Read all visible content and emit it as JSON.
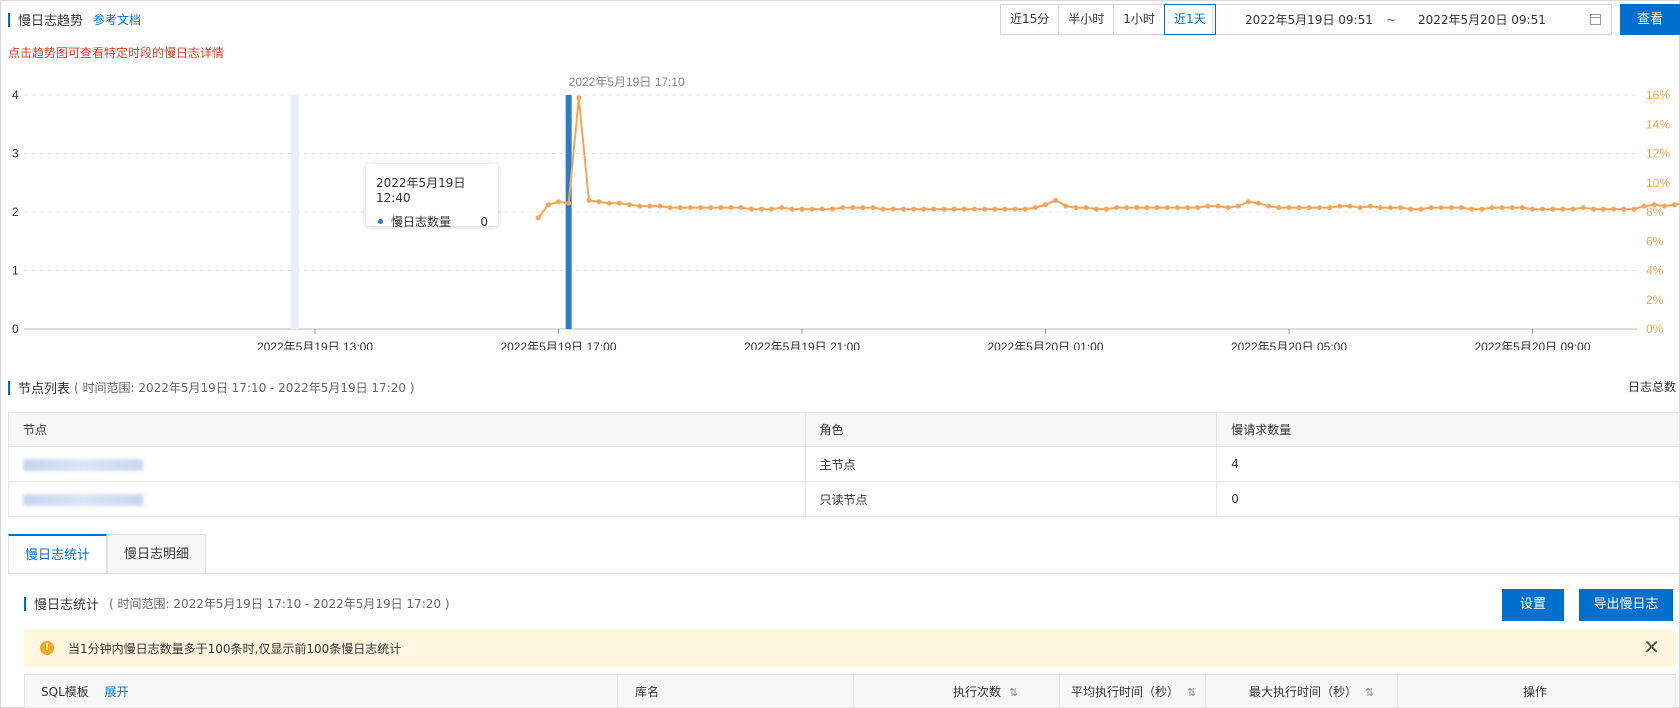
{
  "header": {
    "title": "慢日志趋势",
    "doc_link": "参考文档",
    "hint": "点击趋势图可查看特定时段的慢日志详情",
    "ranges": [
      "近15分",
      "半小时",
      "1小时",
      "近1天"
    ],
    "active_range": "近1天",
    "date_start": "2022年5月19日 09:51",
    "date_sep": "~",
    "date_end": "2022年5月20日 09:51",
    "query_button": "查看"
  },
  "chart_data": {
    "type": "line",
    "title": "",
    "x_tick_labels": [
      "2022年5月19日 13:00",
      "2022年5月19日 17:00",
      "2022年5月19日 21:00",
      "2022年5月20日 01:00",
      "2022年5月20日 05:00",
      "2022年5月20日 09:00"
    ],
    "y_left_ticks": [
      "0",
      "1",
      "2",
      "3",
      "4"
    ],
    "y_left_range": [
      0,
      4
    ],
    "y_right_ticks": [
      "0%",
      "2%",
      "4%",
      "6%",
      "8%",
      "10%",
      "12%",
      "14%",
      "16%"
    ],
    "y_right_range": [
      0,
      16
    ],
    "grid": true,
    "bar_series": {
      "name": "慢日志数量",
      "color": "#2f7bc7",
      "points": [
        {
          "time": "2022年5月19日 17:10",
          "value": 4
        }
      ]
    },
    "line_series": {
      "color": "#f5a55a",
      "start_time": "2022年5月19日 16:40",
      "interval_minutes": 10,
      "values": [
        7.6,
        8.5,
        8.7,
        8.6,
        15.8,
        8.8,
        8.7,
        8.6,
        8.6,
        8.5,
        8.4,
        8.4,
        8.4,
        8.3,
        8.3,
        8.3,
        8.3,
        8.3,
        8.3,
        8.3,
        8.3,
        8.2,
        8.2,
        8.2,
        8.3,
        8.2,
        8.2,
        8.2,
        8.2,
        8.2,
        8.3,
        8.3,
        8.3,
        8.3,
        8.2,
        8.2,
        8.2,
        8.2,
        8.2,
        8.2,
        8.2,
        8.2,
        8.2,
        8.2,
        8.2,
        8.2,
        8.2,
        8.2,
        8.2,
        8.3,
        8.5,
        8.8,
        8.4,
        8.3,
        8.3,
        8.2,
        8.2,
        8.3,
        8.3,
        8.3,
        8.3,
        8.3,
        8.3,
        8.3,
        8.3,
        8.3,
        8.4,
        8.4,
        8.3,
        8.4,
        8.7,
        8.6,
        8.4,
        8.3,
        8.3,
        8.3,
        8.3,
        8.3,
        8.3,
        8.4,
        8.4,
        8.3,
        8.4,
        8.3,
        8.3,
        8.3,
        8.2,
        8.2,
        8.3,
        8.3,
        8.3,
        8.3,
        8.2,
        8.2,
        8.3,
        8.3,
        8.3,
        8.3,
        8.2,
        8.2,
        8.2,
        8.2,
        8.2,
        8.3,
        8.2,
        8.2,
        8.2,
        8.2,
        8.2,
        8.4,
        8.5,
        8.4,
        8.5,
        8.6,
        8.6,
        8.7,
        8.7,
        8.7,
        8.7,
        8.8,
        8.7,
        8.8
      ]
    },
    "hover_marker_time": "2022年5月19日 12:40",
    "peak_label": "2022年5月19日 17:10",
    "tooltip": {
      "time": "2022年5月19日 12:40",
      "series": "慢日志数量",
      "value": "0"
    }
  },
  "nodes": {
    "title": "节点列表",
    "range": "( 时间范围: 2022年5月19日 17:10 - 2022年5月19日 17:20 )",
    "total_label": "日志总数",
    "columns": [
      "节点",
      "角色",
      "慢请求数量"
    ],
    "rows": [
      {
        "role": "主节点",
        "count": "4"
      },
      {
        "role": "只读节点",
        "count": "0"
      }
    ]
  },
  "tabs": [
    "慢日志统计",
    "慢日志明细"
  ],
  "stats": {
    "title": "慢日志统计",
    "range": "( 时间范围: 2022年5月19日 17:10 - 2022年5月19日 17:20 )",
    "settings_button": "设置",
    "export_button": "导出慢日志",
    "warning": "当1分钟内慢日志数量多于100条时,仅显示前100条慢日志统计",
    "columns": {
      "sql": "SQL模板",
      "expand": "展开",
      "db": "库名",
      "exec_count": "执行次数",
      "avg_time": "平均执行时间（秒）",
      "max_time": "最大执行时间（秒）",
      "ops": "操作"
    }
  }
}
